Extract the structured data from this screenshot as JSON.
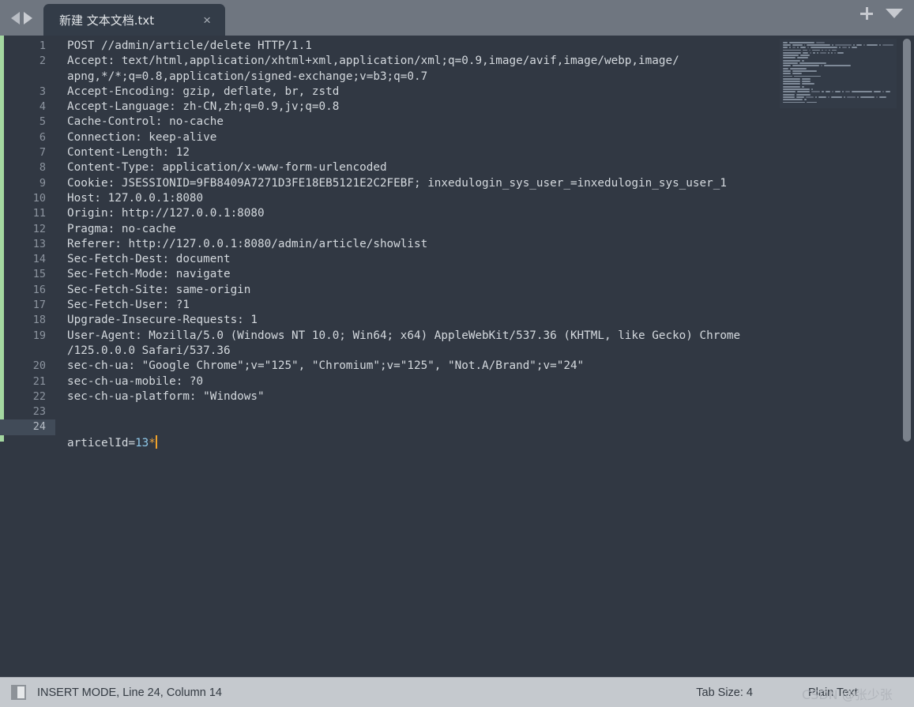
{
  "window": {
    "tab_title": "新建 文本文档.txt",
    "close_label": "×",
    "nav_back_icon": "triangle-left-icon",
    "nav_forward_icon": "triangle-right-icon",
    "new_tab_icon": "plus-icon",
    "tab_menu_icon": "caret-down-icon"
  },
  "editor": {
    "line_numbers": [
      "1",
      "2",
      "",
      "3",
      "4",
      "5",
      "6",
      "7",
      "8",
      "9",
      "10",
      "11",
      "12",
      "13",
      "14",
      "15",
      "16",
      "17",
      "18",
      "19",
      "",
      "20",
      "21",
      "22",
      "23",
      "24"
    ],
    "active_line_index": 25,
    "lines": [
      "POST //admin/article/delete HTTP/1.1",
      "Accept: text/html,application/xhtml+xml,application/xml;q=0.9,image/avif,image/webp,image/",
      "apng,*/*;q=0.8,application/signed-exchange;v=b3;q=0.7",
      "Accept-Encoding: gzip, deflate, br, zstd",
      "Accept-Language: zh-CN,zh;q=0.9,jv;q=0.8",
      "Cache-Control: no-cache",
      "Connection: keep-alive",
      "Content-Length: 12",
      "Content-Type: application/x-www-form-urlencoded",
      "Cookie: JSESSIONID=9FB8409A7271D3FE18EB5121E2C2FEBF; inxedulogin_sys_user_=inxedulogin_sys_user_1",
      "Host: 127.0.0.1:8080",
      "Origin: http://127.0.0.1:8080",
      "Pragma: no-cache",
      "Referer: http://127.0.0.1:8080/admin/article/showlist",
      "Sec-Fetch-Dest: document",
      "Sec-Fetch-Mode: navigate",
      "Sec-Fetch-Site: same-origin",
      "Sec-Fetch-User: ?1",
      "Upgrade-Insecure-Requests: 1",
      "User-Agent: Mozilla/5.0 (Windows NT 10.0; Win64; x64) AppleWebKit/537.36 (KHTML, like Gecko) Chrome",
      "/125.0.0.0 Safari/537.36",
      "sec-ch-ua: \"Google Chrome\";v=\"125\", \"Chromium\";v=\"125\", \"Not.A/Brand\";v=\"24\"",
      "sec-ch-ua-mobile: ?0",
      "sec-ch-ua-platform: \"Windows\"",
      "",
      ""
    ],
    "last_line": {
      "prefix": "articelId=",
      "number": "13",
      "star": "*"
    },
    "colors": {
      "background": "#313843",
      "text": "#d4d9de",
      "gutter_text": "#8c949f",
      "active_gutter": "#414b58",
      "caret": "#f0a32b",
      "number_token": "#8fc8e8",
      "star_token": "#e8a33d",
      "change_marker": "#a4d7a0",
      "tabbar": "#6f7680",
      "active_tab": "#333c48",
      "statusbar": "#c5c9ce"
    }
  },
  "statusbar": {
    "pane_toggle_icon": "split-pane-icon",
    "mode_text": "INSERT MODE, Line 24, Column 14",
    "tab_size": "Tab Size: 4",
    "language": "Plain Text",
    "watermark": "CSDN @张少张"
  }
}
